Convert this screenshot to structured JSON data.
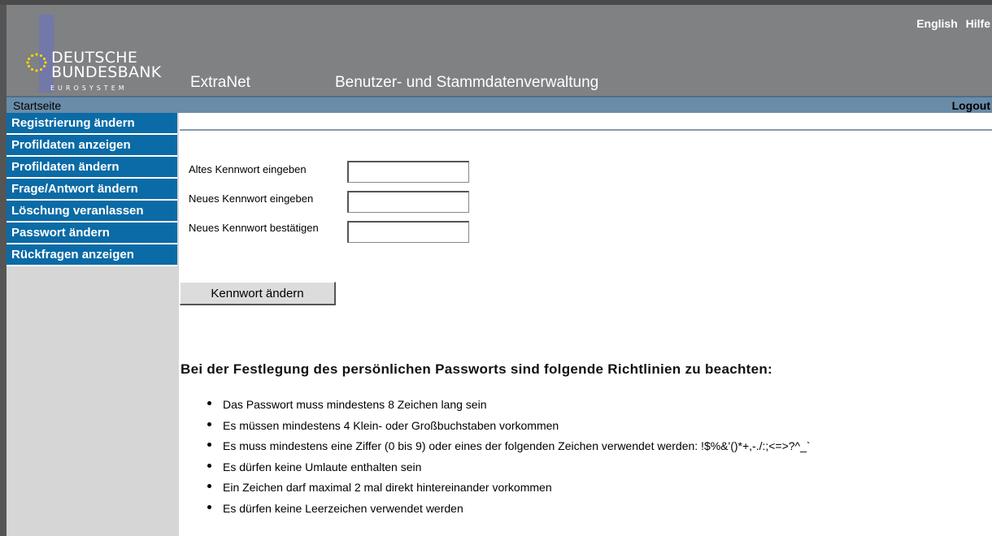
{
  "header": {
    "logo": {
      "line1": "DEUTSCHE",
      "line2": "BUNDESBANK",
      "line3": "EUROSYSTEM"
    },
    "app_name": "ExtraNet",
    "title": "Benutzer- und Stammdatenverwaltung",
    "links": [
      "English",
      "Hilfe"
    ]
  },
  "navbar": {
    "home": "Startseite",
    "logout": "Logout"
  },
  "sidebar": {
    "items": [
      "Registrierung ändern",
      "Profildaten anzeigen",
      "Profildaten ändern",
      "Frage/Antwort ändern",
      "Löschung veranlassen",
      "Passwort ändern",
      "Rückfragen anzeigen"
    ]
  },
  "form": {
    "old_password_label": "Altes Kennwort eingeben",
    "old_password_value": "",
    "new_password_label": "Neues Kennwort eingeben",
    "new_password_value": "",
    "confirm_password_label": "Neues Kennwort bestätigen",
    "confirm_password_value": "",
    "submit_label": "Kennwort ändern"
  },
  "rules": {
    "title": "Bei der Festlegung des persönlichen Passworts sind folgende Richtlinien zu beachten:",
    "items": [
      "Das Passwort muss mindestens 8 Zeichen lang sein",
      "Es müssen mindestens 4 Klein- oder Großbuchstaben vorkommen",
      "Es muss mindestens eine Ziffer (0 bis 9) oder eines der folgenden Zeichen verwendet werden: !$%&'()*+,-./:;<=>?^_`",
      "Es dürfen keine Umlaute enthalten sein",
      "Ein Zeichen darf maximal 2 mal direkt hintereinander vorkommen",
      "Es dürfen keine Leerzeichen verwendet werden"
    ]
  },
  "colors": {
    "header_bg": "#7f8183",
    "navbar_bg": "#6a8ca8",
    "menu_bg": "#0b6ba6",
    "sidebar_bg": "#d6d6d6"
  }
}
